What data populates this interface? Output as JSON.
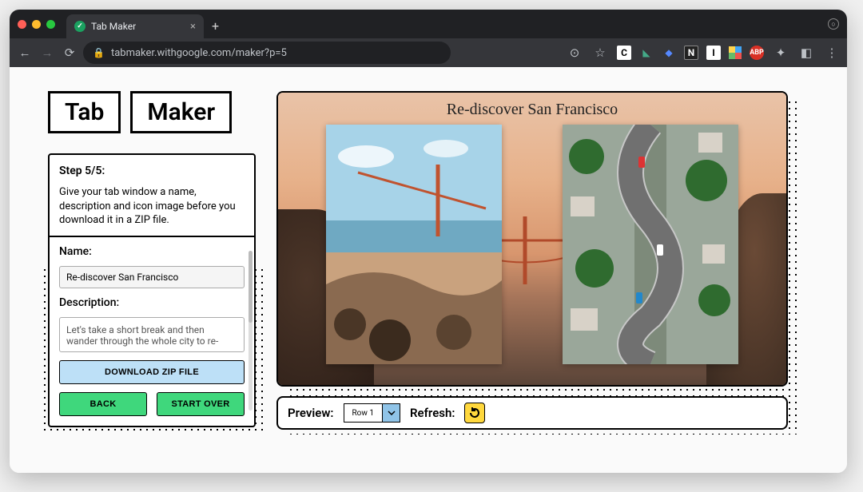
{
  "browser": {
    "tab_title": "Tab Maker",
    "url": "tabmaker.withgoogle.com/maker?p=5"
  },
  "logo": {
    "word1": "Tab",
    "word2": "Maker"
  },
  "panel": {
    "step": "Step 5/5:",
    "desc": "Give your tab window a name, description and icon image before you download it in a ZIP file.",
    "name_label": "Name:",
    "name_value": "Re-discover San Francisco",
    "desc_label": "Description:",
    "desc_value": "Let's take a short break and then wander through the whole city to re-",
    "download": "DOWNLOAD ZIP FILE",
    "back": "BACK",
    "start_over": "START OVER"
  },
  "preview": {
    "title": "Re-discover San Francisco"
  },
  "controls": {
    "preview_label": "Preview:",
    "selected_row": "Row 1",
    "refresh_label": "Refresh:"
  }
}
